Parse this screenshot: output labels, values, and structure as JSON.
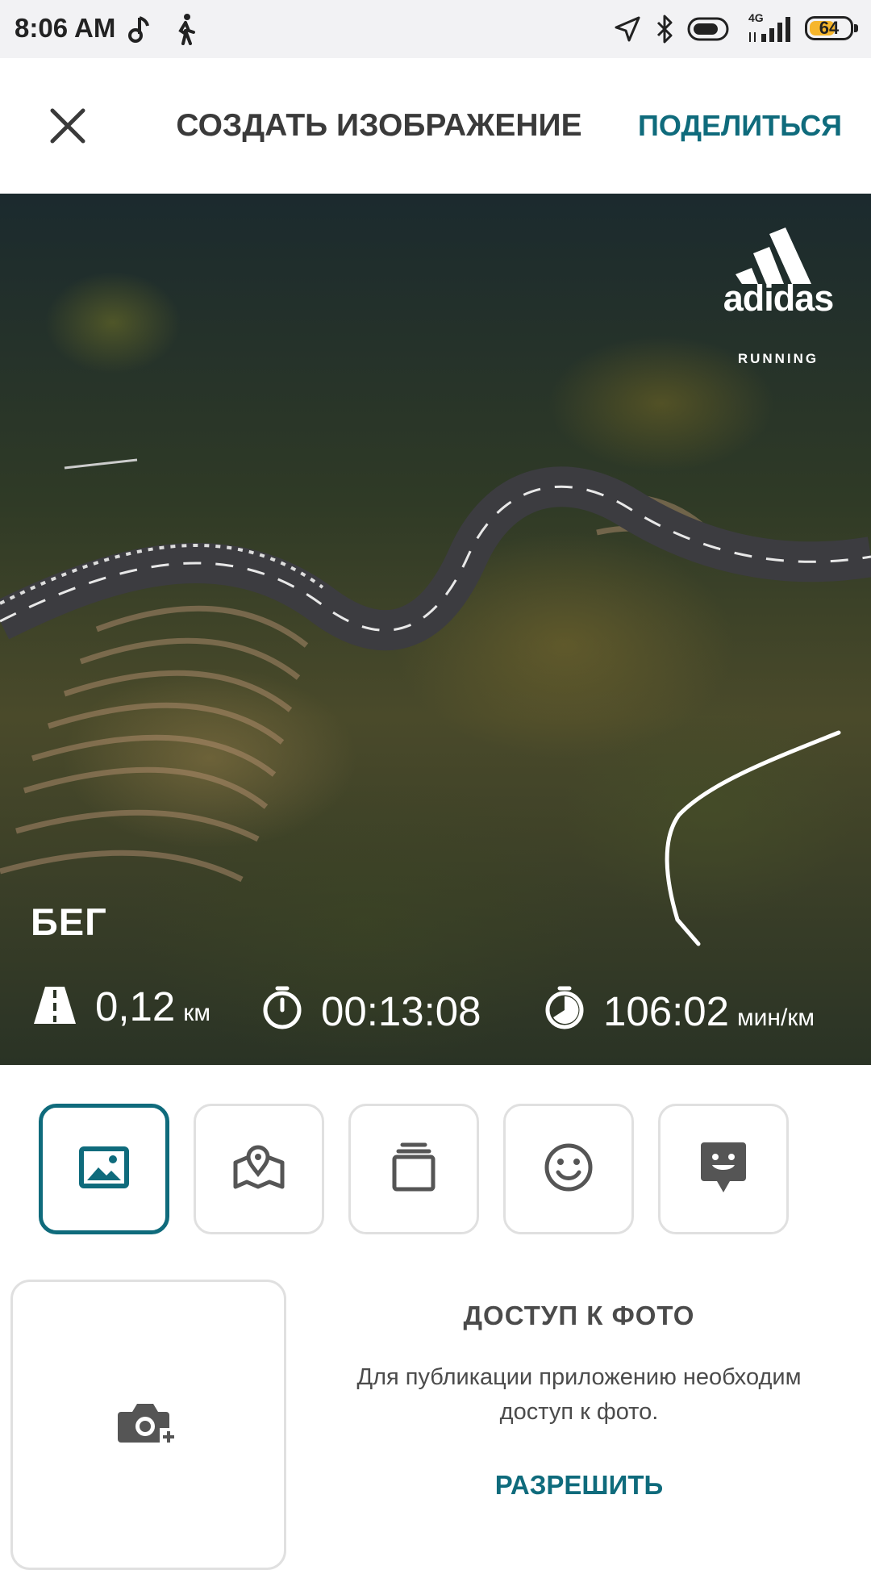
{
  "status_bar": {
    "time": "8:06 AM",
    "network": "4G",
    "battery": "64",
    "battery_level": 0.64,
    "icons": [
      "music-note-icon",
      "walking-icon",
      "location-arrow-icon",
      "bluetooth-icon",
      "toggle-icon",
      "signal-icon",
      "battery-icon"
    ]
  },
  "header": {
    "title": "СОЗДАТЬ ИЗОБРАЖЕНИЕ",
    "share_label": "ПОДЕЛИТЬСЯ",
    "close_icon": "close-icon"
  },
  "photo": {
    "brand": "adidas",
    "brand_sub": "RUNNING",
    "activity": "БЕГ",
    "stats": [
      {
        "icon": "road-icon",
        "value": "0,12",
        "unit": "км"
      },
      {
        "icon": "stopwatch-icon",
        "value": "00:13:08",
        "unit": ""
      },
      {
        "icon": "pace-icon",
        "value": "106:02",
        "unit": "мин/км"
      }
    ]
  },
  "tools": [
    {
      "icon": "image-icon",
      "active": true
    },
    {
      "icon": "map-pin-icon",
      "active": false
    },
    {
      "icon": "layers-icon",
      "active": false
    },
    {
      "icon": "smiley-icon",
      "active": false
    },
    {
      "icon": "sticker-icon",
      "active": false
    }
  ],
  "permission": {
    "title": "ДОСТУП К ФОТО",
    "body": "Для публикации приложению необходим доступ к фото.",
    "allow_label": "РАЗРЕШИТЬ"
  },
  "colors": {
    "accent": "#0f6b7c",
    "title": "#3a3a3a",
    "border": "#e0e0e0"
  }
}
